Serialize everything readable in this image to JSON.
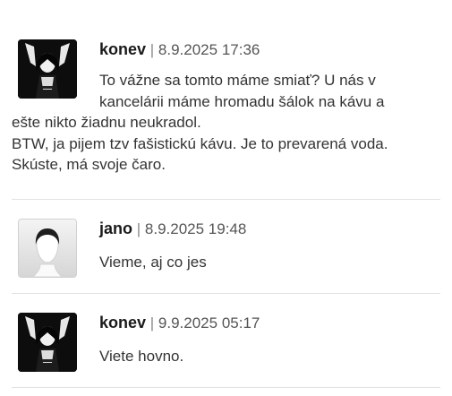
{
  "comments": [
    {
      "author": "konev",
      "separator": "|",
      "timestamp": "8.9.2025 17:36",
      "avatar_icon": "dark-figure-raised-arms-avatar",
      "lines": [
        "To vážne sa tomto máme smiať? U nás v",
        "kancelárii máme hromadu šálok na kávu a",
        "ešte nikto žiadnu neukradol.",
        "BTW, ja pijem tzv fašistickú kávu. Je to prevarená voda.",
        "Skúste, má svoje čaro."
      ]
    },
    {
      "author": "jano",
      "separator": "|",
      "timestamp": "8.9.2025 19:48",
      "avatar_icon": "default-silhouette-avatar",
      "lines": [
        "Vieme, aj co jes"
      ]
    },
    {
      "author": "konev",
      "separator": "|",
      "timestamp": "9.9.2025 05:17",
      "avatar_icon": "dark-figure-raised-arms-avatar",
      "lines": [
        "Viete hovno."
      ]
    }
  ]
}
